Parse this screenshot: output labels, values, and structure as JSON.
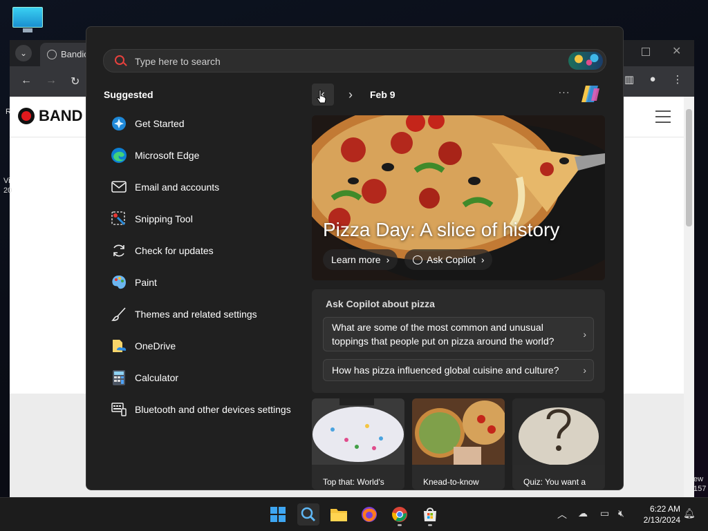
{
  "browser": {
    "tab_title": "Bandica",
    "brand": "BAND",
    "side_left": [
      "R",
      "Vi",
      "20"
    ],
    "side_right": [
      "ew",
      "157"
    ]
  },
  "search": {
    "placeholder": "Type here to search"
  },
  "suggested": {
    "title": "Suggested",
    "items": [
      {
        "label": "Get Started",
        "icon": "get-started-icon"
      },
      {
        "label": "Microsoft Edge",
        "icon": "edge-icon"
      },
      {
        "label": "Email and accounts",
        "icon": "mail-icon"
      },
      {
        "label": "Snipping Tool",
        "icon": "snipping-tool-icon"
      },
      {
        "label": "Check for updates",
        "icon": "update-icon"
      },
      {
        "label": "Paint",
        "icon": "paint-icon"
      },
      {
        "label": "Themes and related settings",
        "icon": "brush-icon"
      },
      {
        "label": "OneDrive",
        "icon": "onedrive-icon"
      },
      {
        "label": "Calculator",
        "icon": "calculator-icon"
      },
      {
        "label": "Bluetooth and other devices settings",
        "icon": "devices-icon"
      }
    ]
  },
  "highlights": {
    "date": "Feb 9",
    "more": "···",
    "hero_title": "Pizza Day: A slice of history",
    "learn_more": "Learn more",
    "ask_copilot": "Ask Copilot"
  },
  "ask": {
    "title": "Ask Copilot about pizza",
    "q1_line1": "What are some of the most common and unusual",
    "q1_line2": "toppings that people put on pizza around the world?",
    "q2": "How has pizza influenced global cuisine and culture?"
  },
  "cards": [
    {
      "text": "Top that: World's"
    },
    {
      "text": "Knead-to-know"
    },
    {
      "text": "Quiz: You want a"
    }
  ],
  "clock": {
    "time": "6:22 AM",
    "date": "2/13/2024"
  },
  "colors": {
    "accent_search": "#e8413d",
    "panel_bg": "#202020"
  }
}
